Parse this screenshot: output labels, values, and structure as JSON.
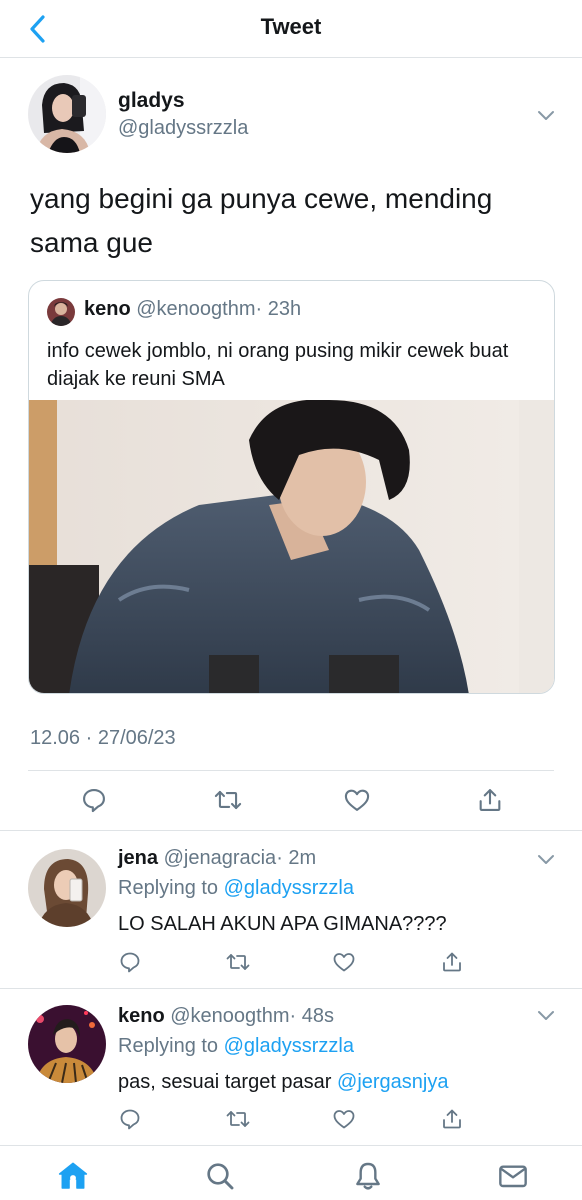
{
  "header": {
    "title": "Tweet"
  },
  "tweet": {
    "name": "gladys",
    "handle": "@gladyssrzzla",
    "text": "yang begini ga punya cewe, mending sama gue",
    "timestamp": "12.06 · 27/06/23",
    "quote": {
      "name": "keno",
      "handle": "@kenoogthm",
      "time": "· 23h",
      "text": "info cewek jomblo, ni orang pusing mikir cewek buat diajak ke reuni SMA"
    }
  },
  "replies": [
    {
      "name": "jena",
      "handle": "@jenagracia",
      "time": "· 2m",
      "replying_prefix": "Replying to ",
      "replying_to": "@gladyssrzzla",
      "text": "LO SALAH AKUN APA GIMANA????",
      "mention": ""
    },
    {
      "name": "keno",
      "handle": "@kenoogthm",
      "time": "· 48s",
      "replying_prefix": "Replying to ",
      "replying_to": "@gladyssrzzla",
      "text": "pas, sesuai target pasar ",
      "mention": "@jergasnjya"
    }
  ],
  "icons": {
    "back": "chevron-left-icon",
    "more": "chevron-down-icon",
    "reply": "comment-icon",
    "retweet": "retweet-icon",
    "like": "heart-icon",
    "share": "share-icon",
    "home": "home-icon",
    "search": "search-icon",
    "notifications": "bell-icon",
    "messages": "mail-icon"
  },
  "colors": {
    "accent": "#1da1f2",
    "secondary_text": "#657786",
    "divider": "#dfe3e6",
    "icon": "#657786"
  }
}
